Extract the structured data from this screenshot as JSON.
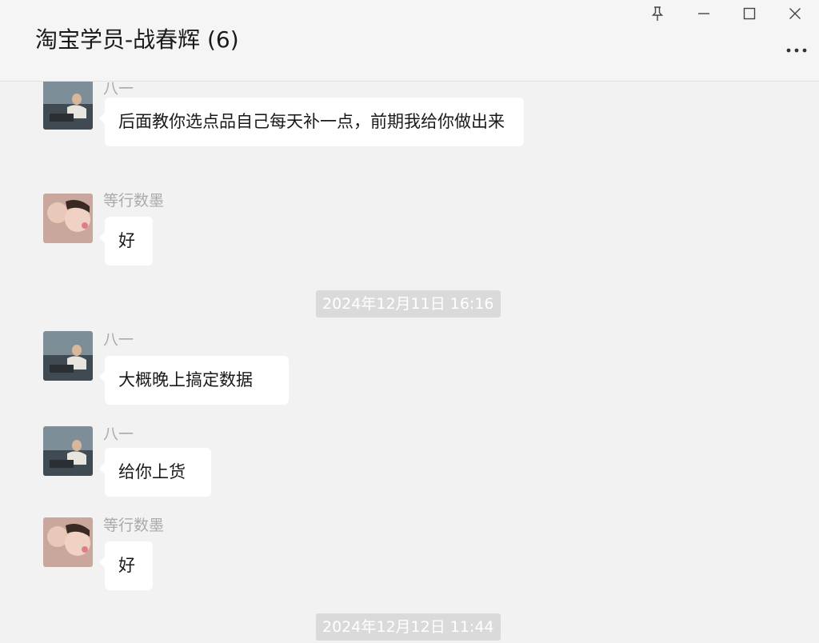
{
  "window": {
    "title": "淘宝学员-战春辉 (6)",
    "controls": {
      "pin_icon": "pin-icon",
      "minimize_icon": "minimize-icon",
      "maximize_icon": "maximize-icon",
      "close_icon": "close-icon",
      "more_icon": "more-icon"
    }
  },
  "messages": [
    {
      "sender": "八一",
      "text": "后面教你选点品自己每天补一点，前期我给你做出来"
    },
    {
      "sender": "等行数墨",
      "text": "好"
    },
    {
      "timestamp": "2024年12月11日 16:16"
    },
    {
      "sender": "八一",
      "text": "大概晚上搞定数据"
    },
    {
      "sender": "八一",
      "text": "给你上货"
    },
    {
      "sender": "等行数墨",
      "text": "好"
    },
    {
      "timestamp": "2024年12月12日 11:44"
    }
  ],
  "colors": {
    "background": "#f2f2f2",
    "bubble": "#ffffff",
    "sender_name": "#aaaaaa",
    "timestamp_bg": "#dadada"
  }
}
